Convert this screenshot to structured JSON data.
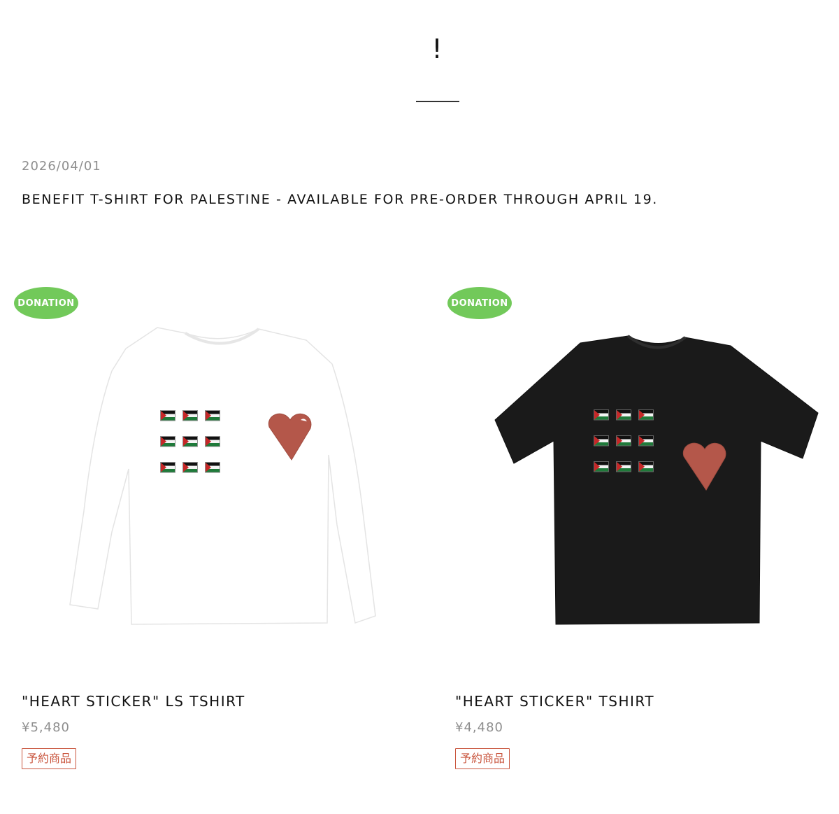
{
  "page": {
    "heading": "!"
  },
  "news": {
    "date": "2026/04/01",
    "title": "BENEFIT T-SHIRT FOR PALESTINE - AVAILABLE FOR PRE-ORDER THROUGH APRIL 19."
  },
  "products": [
    {
      "badge": "DONATION",
      "name": "\"HEART STICKER\" LS TSHIRT",
      "price": "¥5,480",
      "tag": "予約商品",
      "shirt_color": "#ffffff",
      "style": "long-sleeve"
    },
    {
      "badge": "DONATION",
      "name": "\"HEART STICKER\" TSHIRT",
      "price": "¥4,480",
      "tag": "予約商品",
      "shirt_color": "#1a1a1a",
      "style": "short-sleeve"
    }
  ],
  "colors": {
    "badge": "#72c95a",
    "tag": "#c9553d",
    "muted_text": "#8e8e8e",
    "heart": "#b4574a"
  }
}
